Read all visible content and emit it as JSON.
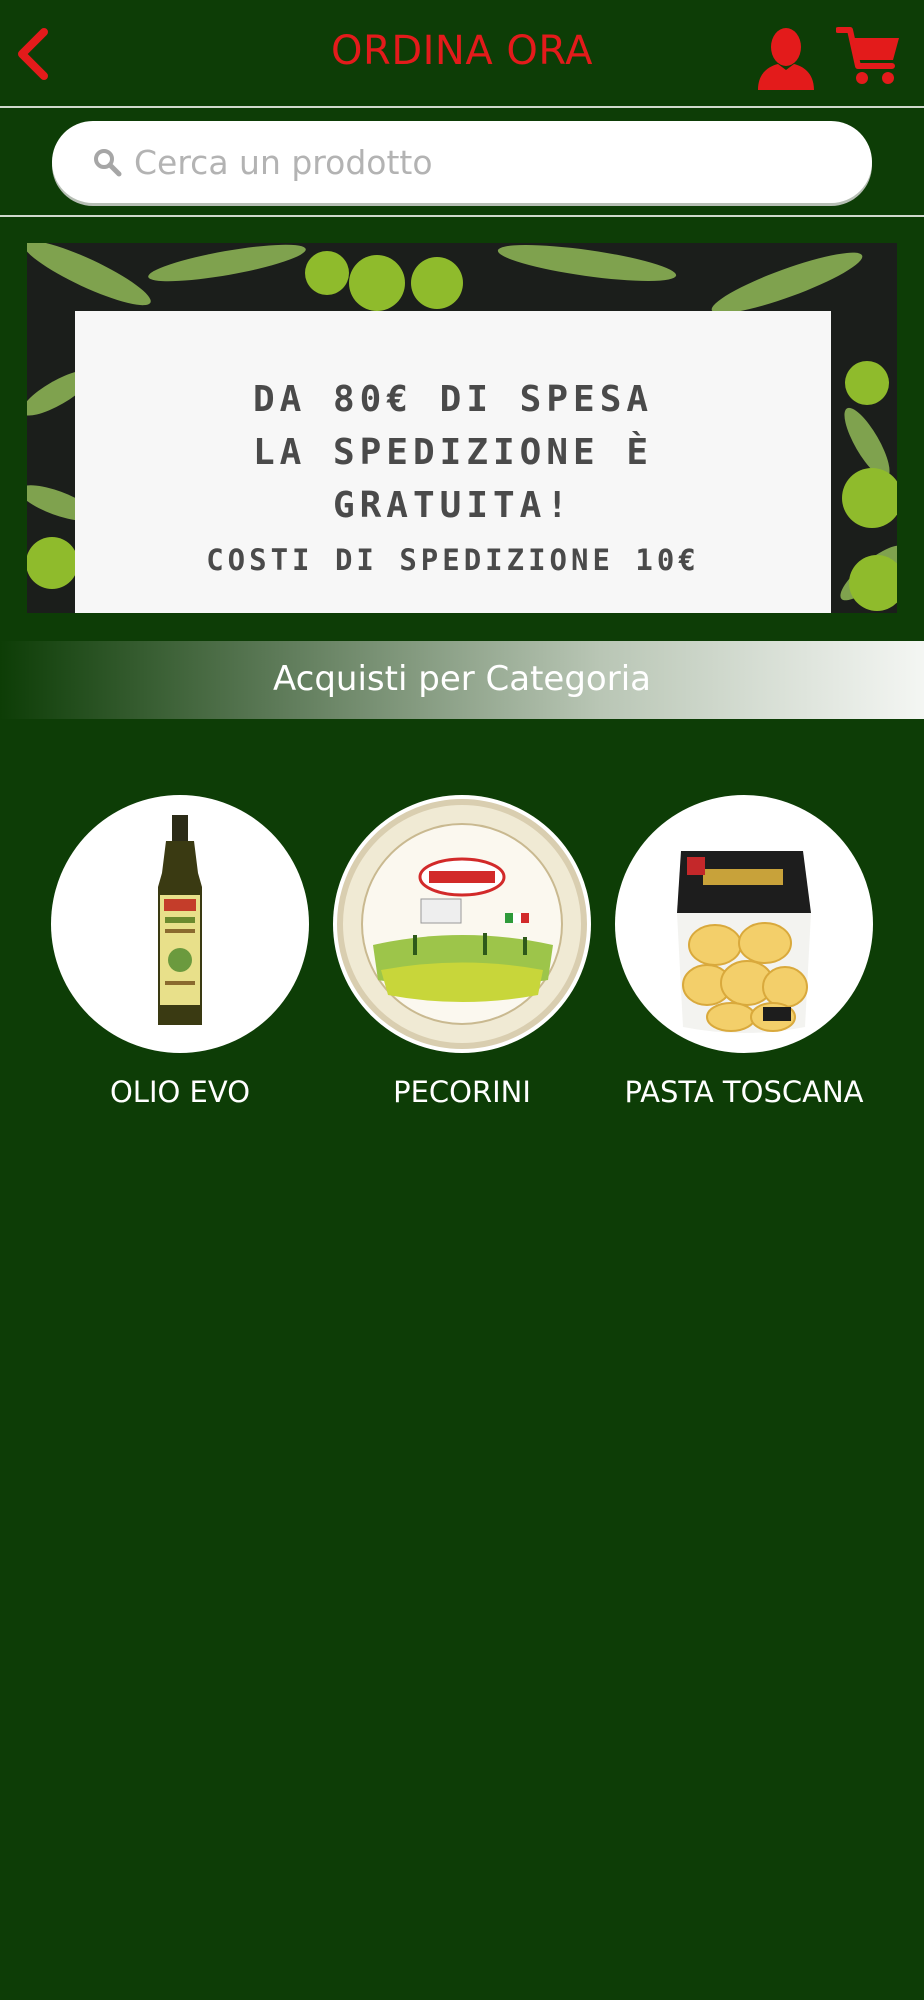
{
  "header": {
    "title": "ORDINA ORA",
    "accent_color": "#e31b1b",
    "icons": [
      "back-icon",
      "user-icon",
      "cart-icon"
    ]
  },
  "search": {
    "placeholder": "Cerca un prodotto",
    "value": ""
  },
  "banner": {
    "lines": [
      "DA 80€ DI SPESA",
      "LA SPEDIZIONE È",
      "GRATUITA!",
      "COSTI DI SPEDIZIONE 10€"
    ]
  },
  "section": {
    "title": "Acquisti per Categoria"
  },
  "categories": [
    {
      "label": "OLIO EVO",
      "image": "olive-oil-bottle"
    },
    {
      "label": "PECORINI",
      "image": "pecorino-cheese-wheel"
    },
    {
      "label": "PASTA TOSCANA",
      "image": "pasta-package"
    }
  ],
  "colors": {
    "background": "#0d3d06",
    "accent": "#e31b1b",
    "text": "#ffffff"
  }
}
